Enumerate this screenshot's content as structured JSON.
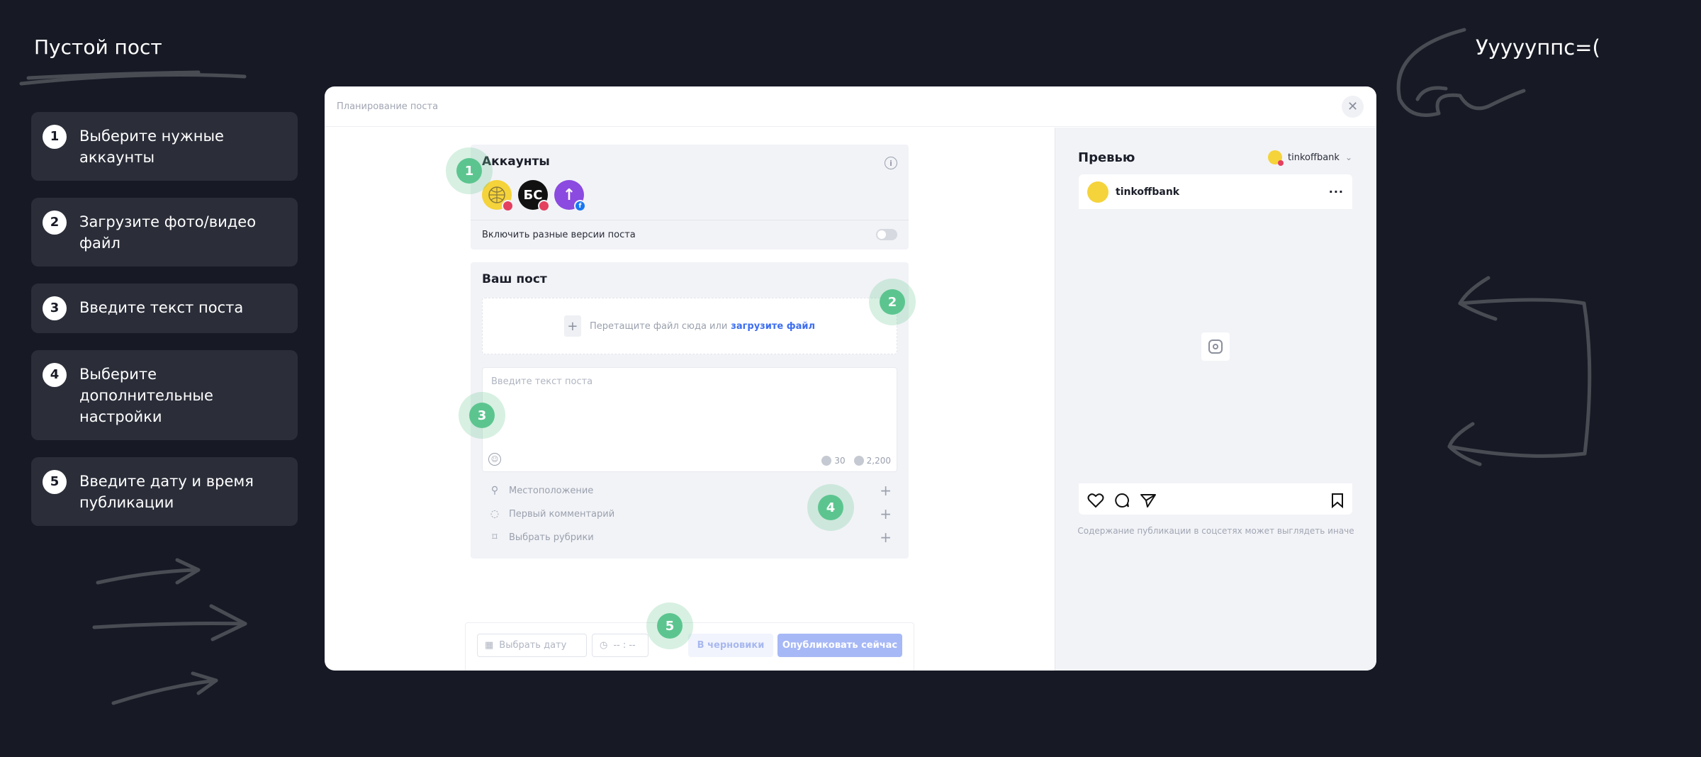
{
  "tutorial": {
    "title": "Пустой пост",
    "oops_text": "Уууууппс=(",
    "steps": [
      {
        "num": "1",
        "label": "Выберите нужные аккаунты"
      },
      {
        "num": "2",
        "label": "Загрузите фото/видео файл"
      },
      {
        "num": "3",
        "label": "Введите текст поста"
      },
      {
        "num": "4",
        "label": "Выберите дополнительные настройки"
      },
      {
        "num": "5",
        "label": "Введите дату и время публикации"
      }
    ]
  },
  "modal": {
    "title": "Планирование поста",
    "close_icon": "close-icon",
    "accounts": {
      "title": "Аккаунты",
      "avatars": [
        {
          "name": "tinkoffbank",
          "network": "instagram",
          "text": ""
        },
        {
          "name": "bc-account",
          "network": "instagram",
          "text": "БС"
        },
        {
          "name": "purple-account",
          "network": "facebook",
          "text": "↑"
        }
      ],
      "versions_label": "Включить разные версии поста"
    },
    "post": {
      "title": "Ваш пост",
      "drop_text": "Перетащите файл сюда или",
      "upload_link": "загрузите файл",
      "text_placeholder": "Введите текст поста",
      "counter_hashtags": "30",
      "counter_chars": "2,200",
      "options": [
        {
          "icon": "location-pin-icon",
          "label": "Местоположение"
        },
        {
          "icon": "comment-icon",
          "label": "Первый комментарий"
        },
        {
          "icon": "bookmark-icon",
          "label": "Выбрать рубрики"
        }
      ]
    },
    "footer": {
      "date_placeholder": "Выбрать дату",
      "time_placeholder": "-- : --",
      "draft_label": "В черновики",
      "publish_label": "Опубликовать сейчас"
    },
    "markers": [
      "1",
      "2",
      "3",
      "4",
      "5"
    ],
    "preview": {
      "title": "Превью",
      "account": "tinkoffbank",
      "post_account": "tinkoffbank",
      "note": "Содержание публикации в соцсетях может выглядеть иначе"
    }
  },
  "colors": {
    "background": "#171a25",
    "step_card": "#2b2e39",
    "marker_green": "#5cc58f",
    "link_blue": "#3d6ef0",
    "publish_button": "#a7b8f6"
  }
}
